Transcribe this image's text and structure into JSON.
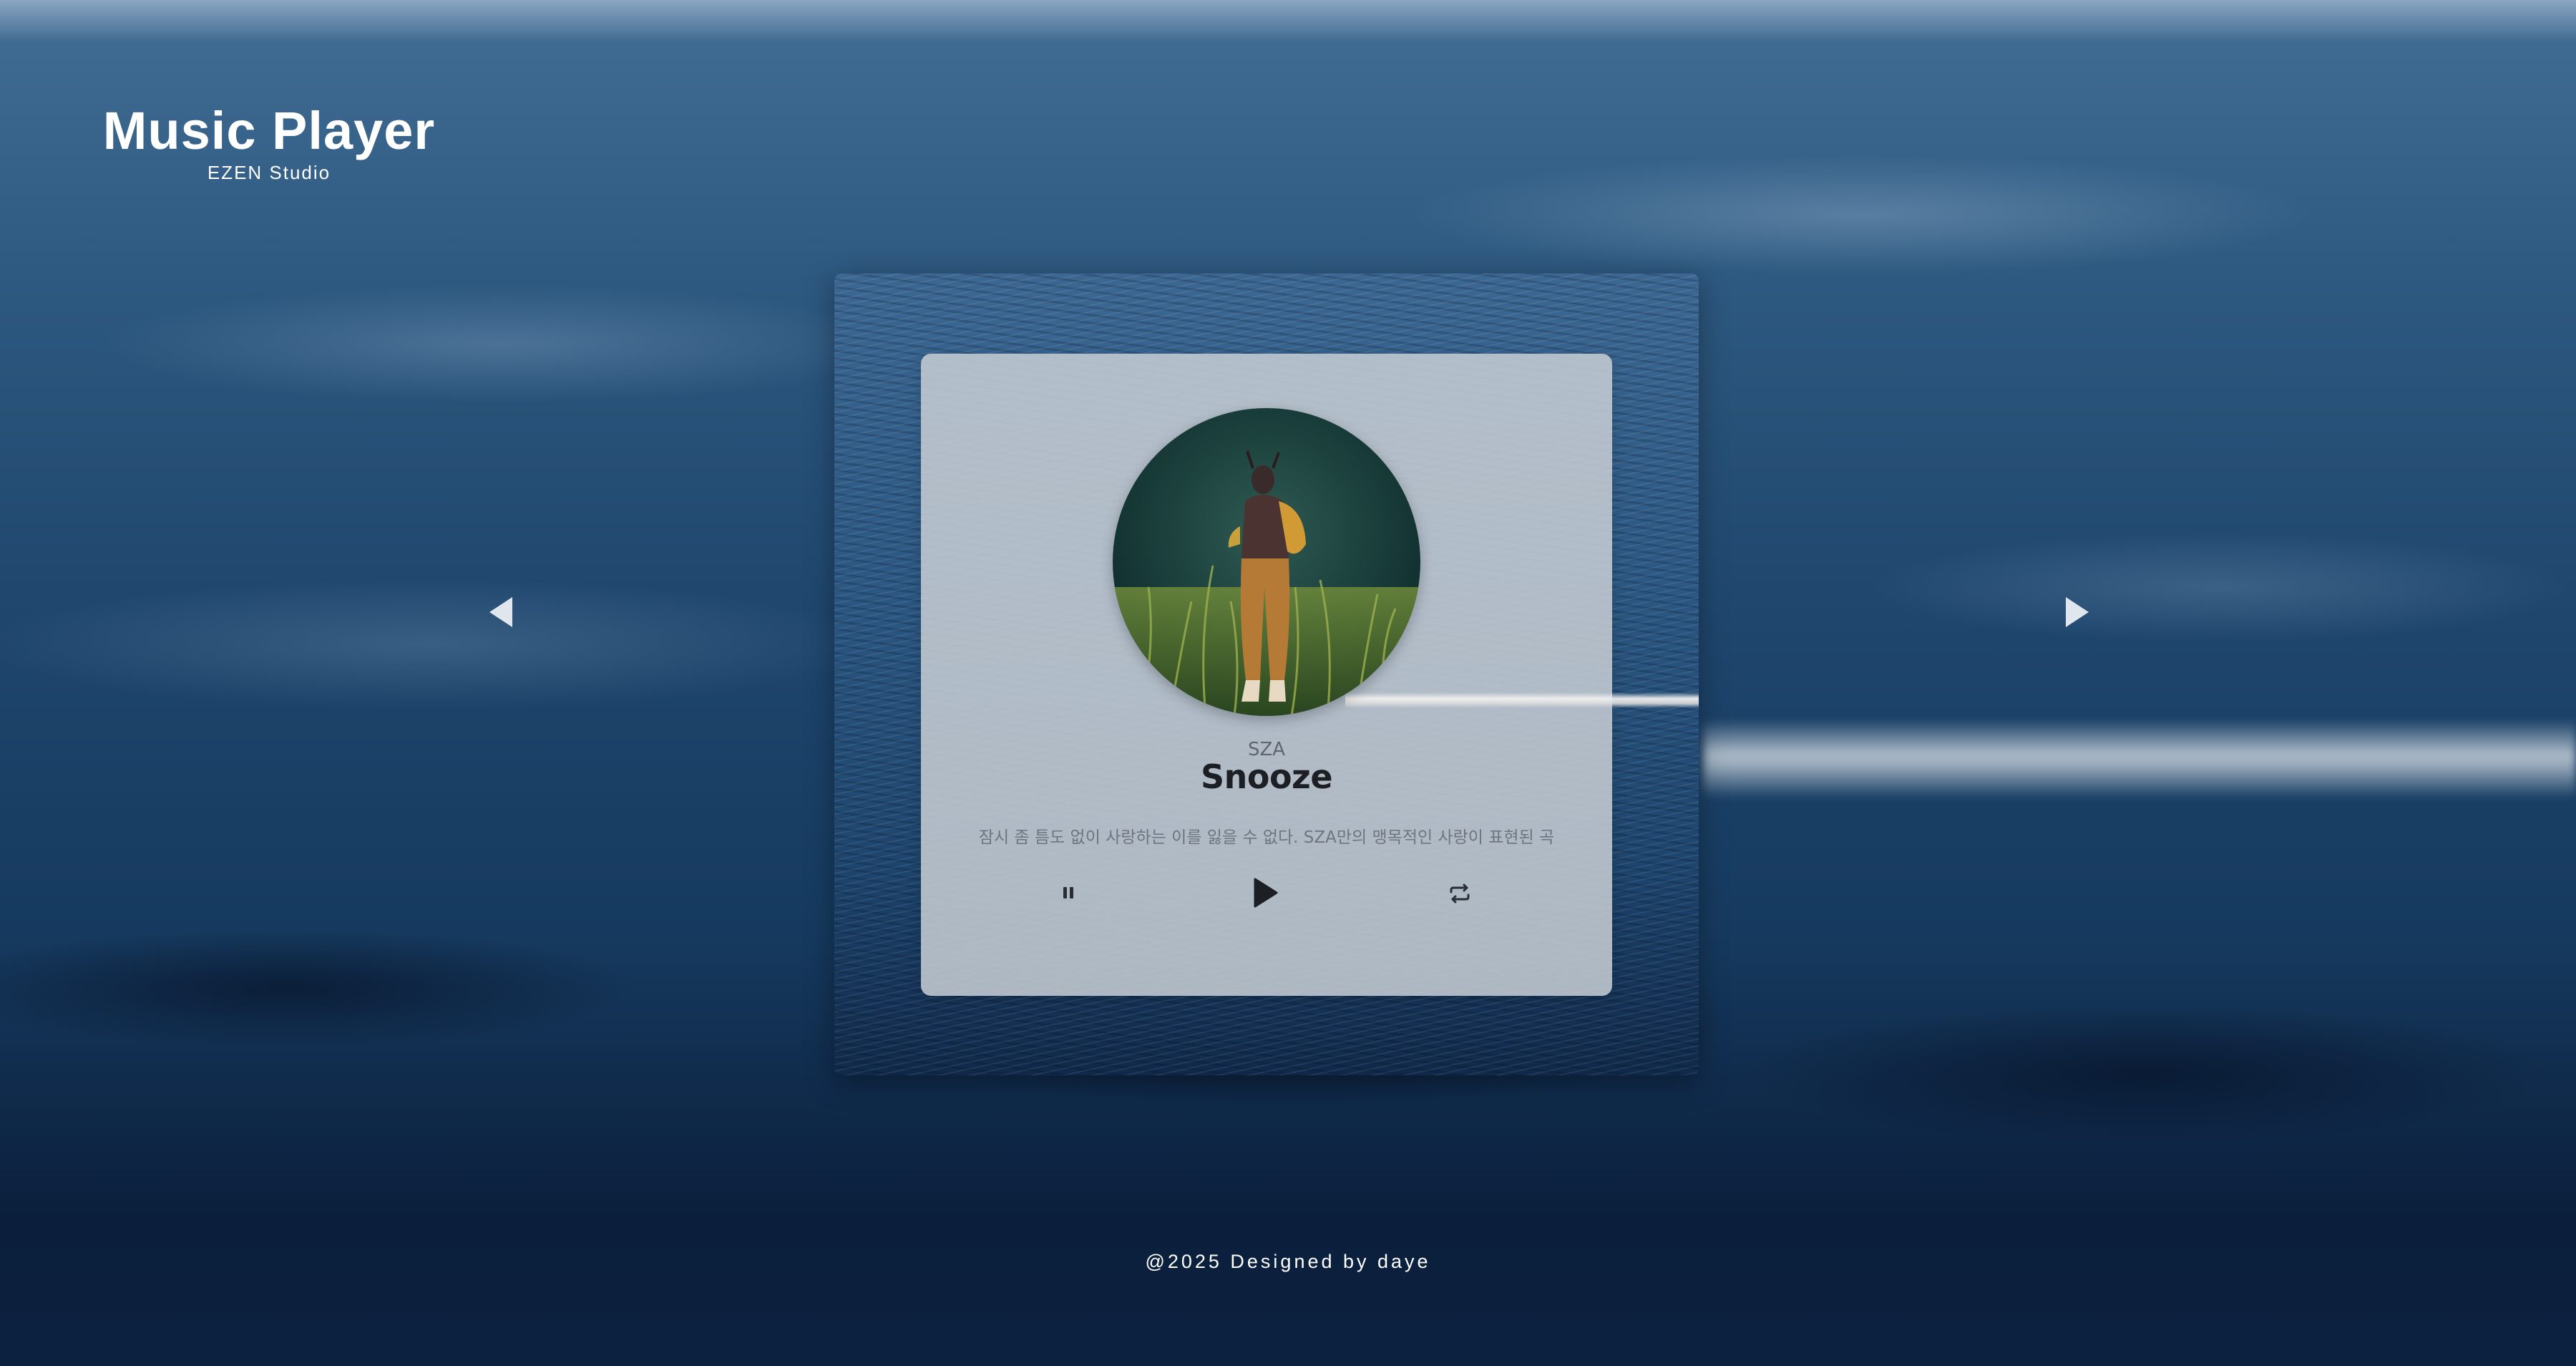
{
  "header": {
    "title": "Music Player",
    "subtitle": "EZEN Studio"
  },
  "navigation": {
    "prev_icon": "triangle-left-icon",
    "next_icon": "triangle-right-icon"
  },
  "player": {
    "artist": "SZA",
    "track_title": "Snooze",
    "description": "잠시 좀 틈도 없이 사랑하는 이를 잃을 수 없다. SZA만의 맹목적인 사랑이 표현된 곡",
    "album_art": "sza-album-cover",
    "controls": {
      "pause_icon": "pause-icon",
      "play_icon": "play-icon",
      "repeat_icon": "repeat-icon"
    }
  },
  "footer": {
    "credit": "@2025 Designed by daye"
  },
  "colors": {
    "card_overlay": "#c4cbd2",
    "title_text": "#1c1f24",
    "body_text": "#6e757e",
    "background_deep": "#0b1f3c",
    "background_mid": "#2d587f"
  }
}
